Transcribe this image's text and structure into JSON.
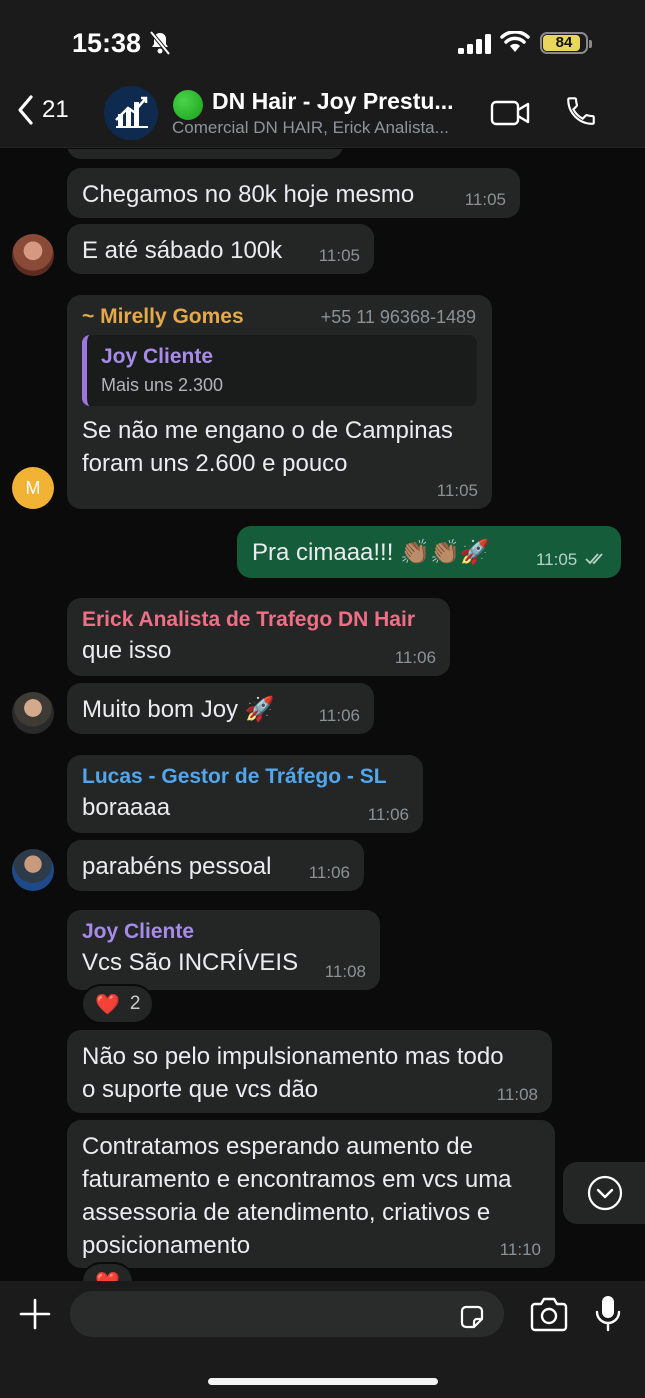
{
  "status_bar": {
    "time": "15:38",
    "battery": "84"
  },
  "header": {
    "back_count": "21",
    "title": "DN Hair - Joy Prestu...",
    "subtitle": "Comercial DN HAIR, Erick Analista..."
  },
  "colors": {
    "incoming_bubble": "#242626",
    "outgoing_bubble": "#155c3a",
    "sender_mirelly": "#e5a94a",
    "sender_erick": "#ee6f86",
    "sender_lucas": "#53a6ec",
    "sender_joy": "#a78be8"
  },
  "messages": [
    {
      "text": "Chegamos no 80k hoje mesmo",
      "time": "11:05"
    },
    {
      "text": "E até sábado 100k",
      "time": "11:05"
    },
    {
      "sender": "~ Mirelly Gomes",
      "phone": "+55 11 96368-1489",
      "quote_name": "Joy Cliente",
      "quote_text": "Mais uns 2.300",
      "text_lines": [
        "Se não me engano o de Campinas",
        "foram uns 2.600 e pouco"
      ],
      "time": "11:05",
      "avatar_letter": "M"
    },
    {
      "text": "Pra cimaaa!!! 👏🏽👏🏽🚀",
      "time": "11:05",
      "outgoing": true
    },
    {
      "sender": "Erick Analista de Trafego DN Hair",
      "text": "que isso",
      "time": "11:06"
    },
    {
      "text": "Muito bom Joy 🚀",
      "time": "11:06"
    },
    {
      "sender": "Lucas - Gestor de Tráfego - SL",
      "text": "boraaaa",
      "time": "11:06"
    },
    {
      "text": "parabéns pessoal",
      "time": "11:06"
    },
    {
      "sender": "Joy Cliente",
      "text": "Vcs São INCRÍVEIS",
      "time": "11:08",
      "reaction": "❤️",
      "reaction_count": "2"
    },
    {
      "text_lines": [
        "Não so pelo impulsionamento mas todo",
        "o suporte que vcs dão"
      ],
      "time": "11:08"
    },
    {
      "text_lines": [
        "Contratamos esperando aumento de",
        "faturamento e encontramos em vcs uma",
        "assessoria de atendimento, criativos e",
        "posicionamento"
      ],
      "time": "11:10",
      "reaction": "❤️"
    }
  ],
  "icons": [
    "bell-slash-icon",
    "signal-icon",
    "wifi-icon",
    "chevron-left-icon",
    "video-icon",
    "phone-icon",
    "double-check-icon",
    "chevron-down-icon",
    "plus-icon",
    "sticker-icon",
    "camera-icon",
    "microphone-icon"
  ]
}
